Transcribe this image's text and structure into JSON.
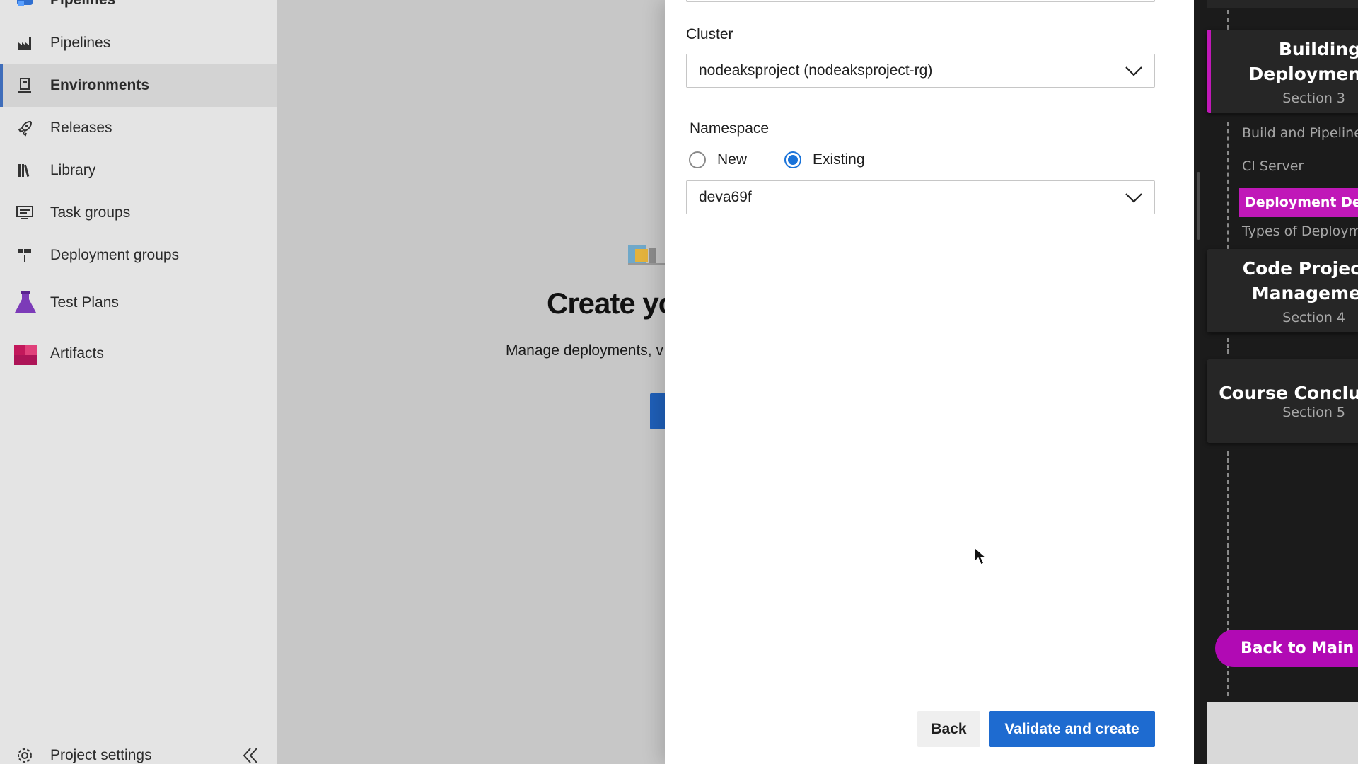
{
  "nav": {
    "items": [
      {
        "label": "Pipelines",
        "icon": "pipelines-icon"
      },
      {
        "label": "Pipelines",
        "icon": "pipelines-sub-icon"
      },
      {
        "label": "Environments",
        "icon": "environments-icon",
        "active": true
      },
      {
        "label": "Releases",
        "icon": "rocket-icon"
      },
      {
        "label": "Library",
        "icon": "library-icon"
      },
      {
        "label": "Task groups",
        "icon": "task-groups-icon"
      },
      {
        "label": "Deployment groups",
        "icon": "deployment-groups-icon"
      },
      {
        "label": "Test Plans",
        "icon": "flask-icon"
      },
      {
        "label": "Artifacts",
        "icon": "artifacts-icon"
      }
    ],
    "settings_label": "Project settings",
    "accent": "#3f6dba"
  },
  "background_page": {
    "title": "Create yo",
    "subtitle": "Manage deployments, v"
  },
  "dialog": {
    "cluster_label": "Cluster",
    "cluster_value": "nodeaksproject (nodeaksproject-rg)",
    "namespace_label": "Namespace",
    "radio_new": "New",
    "radio_existing": "Existing",
    "selected_radio": "Existing",
    "namespace_value": "deva69f",
    "back_label": "Back",
    "validate_label": "Validate and create",
    "primary_color": "#1e6bd0"
  },
  "course": {
    "cards": [
      {
        "title_line1": "Building",
        "title_line2": "Deploymen",
        "section": "Section 3"
      },
      {
        "title_line1": "Code Projec",
        "title_line2": "Manageme",
        "section": "Section 4"
      },
      {
        "title_line1": "Course Conclu",
        "section": "Section 5"
      }
    ],
    "sub_items": [
      "Build and Pipeline",
      "CI Server",
      "Deployment Det",
      "Types of Deploym"
    ],
    "back_to_main": "Back to Main",
    "accent": "#c018b8"
  }
}
